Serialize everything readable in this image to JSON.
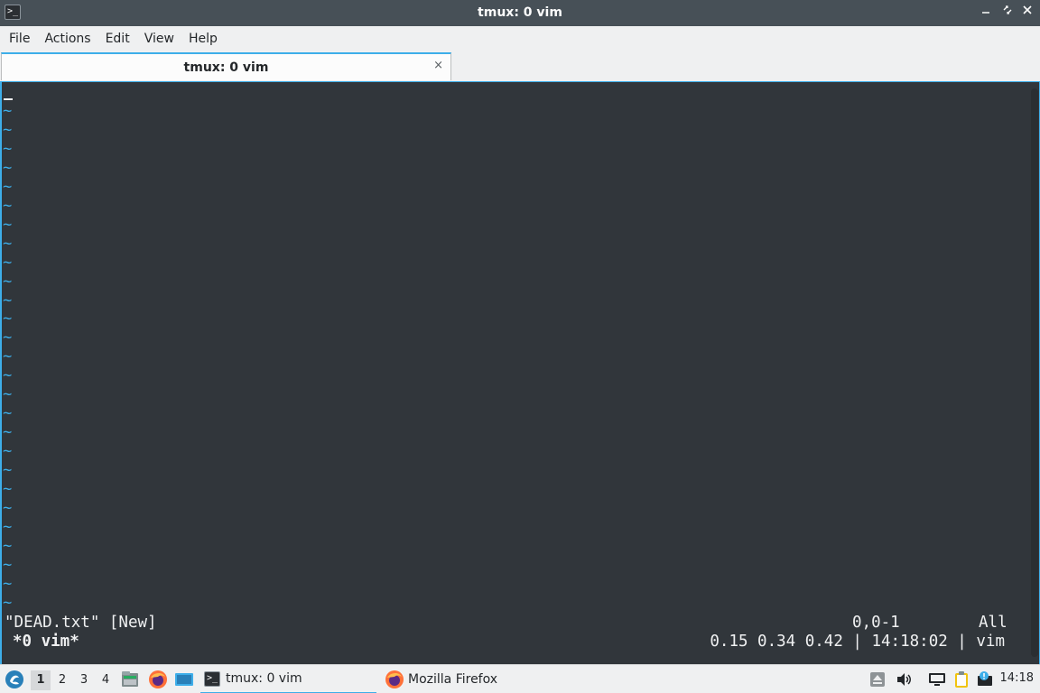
{
  "window": {
    "title": "tmux: 0 vim",
    "app_icon_glyph": ">_",
    "controls": [
      "_",
      "⟡",
      "✕"
    ]
  },
  "menu": {
    "items": [
      "File",
      "Actions",
      "Edit",
      "View",
      "Help"
    ]
  },
  "tabs": [
    {
      "label": "tmux: 0 vim",
      "close": "×"
    }
  ],
  "terminal": {
    "tilde": "~",
    "vim_message": "\"DEAD.txt\" [New]",
    "vim_position": "0,0-1",
    "vim_scroll": "All",
    "tmux_window": "*0 vim*",
    "tmux_status": "0.15 0.34 0.42 | 14:18:02 | vim",
    "colors": {
      "background": "#31363b",
      "tilde": "#3daee9",
      "text": "#eff0f1"
    }
  },
  "taskbar": {
    "workspaces": [
      "1",
      "2",
      "3",
      "4"
    ],
    "active_workspace": "1",
    "launchers": [
      "file-manager-icon",
      "firefox-icon",
      "desktop-icon"
    ],
    "tasks": [
      {
        "label": "tmux: 0 vim",
        "icon": "terminal-icon",
        "active": true
      },
      {
        "label": "Mozilla Firefox",
        "icon": "firefox-icon",
        "active": false
      }
    ],
    "tray_icons": [
      "eject-icon",
      "volume-icon",
      "network-icon",
      "clipboard-icon",
      "update-notifier-icon"
    ],
    "clock": "14:18"
  }
}
